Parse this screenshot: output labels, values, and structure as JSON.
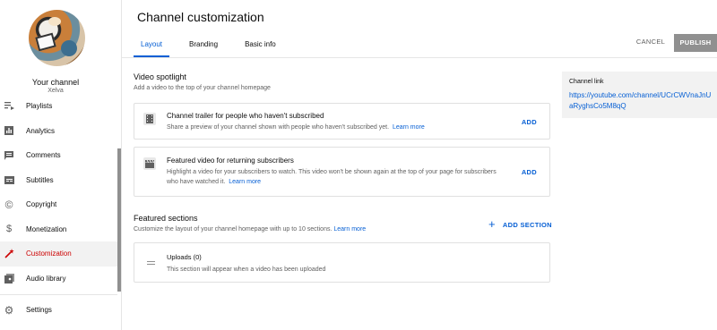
{
  "sidebar": {
    "channel_label": "Your channel",
    "channel_handle": "Xelva",
    "items": [
      {
        "label": "Playlists",
        "icon": "playlist-icon"
      },
      {
        "label": "Analytics",
        "icon": "analytics-icon"
      },
      {
        "label": "Comments",
        "icon": "comments-icon"
      },
      {
        "label": "Subtitles",
        "icon": "subtitles-icon"
      },
      {
        "label": "Copyright",
        "icon": "copyright-icon"
      },
      {
        "label": "Monetization",
        "icon": "dollar-icon"
      },
      {
        "label": "Customization",
        "icon": "magic-wand-icon",
        "active": true
      },
      {
        "label": "Audio library",
        "icon": "audio-library-icon"
      }
    ],
    "settings_label": "Settings"
  },
  "header": {
    "title": "Channel customization",
    "tabs": [
      {
        "label": "Layout",
        "active": true
      },
      {
        "label": "Branding"
      },
      {
        "label": "Basic info"
      }
    ],
    "cancel_label": "CANCEL",
    "publish_label": "PUBLISH"
  },
  "spotlight": {
    "title": "Video spotlight",
    "subtitle": "Add a video to the top of your channel homepage",
    "cards": [
      {
        "title": "Channel trailer for people who haven't subscribed",
        "desc": "Share a preview of your channel shown with people who haven't subscribed yet.",
        "link": "Learn more",
        "action": "ADD"
      },
      {
        "title": "Featured video for returning subscribers",
        "desc": "Highlight a video for your subscribers to watch. This video won't be shown again at the top of your page for subscribers who have watched it.",
        "link": "Learn more",
        "action": "ADD"
      }
    ]
  },
  "featured": {
    "title": "Featured sections",
    "subtitle": "Customize the layout of your channel homepage with up to 10 sections.",
    "link": "Learn more",
    "add_section_label": "ADD SECTION",
    "uploads_title": "Uploads (0)",
    "uploads_desc": "This section will appear when a video has been uploaded"
  },
  "channel_link": {
    "label": "Channel link",
    "url": "https://youtube.com/channel/UCrCWVnaJnUaRyghsCo5M8qQ"
  },
  "colors": {
    "accent": "#065fd4",
    "active_nav": "#cc0000",
    "publish_bg": "#909090"
  }
}
